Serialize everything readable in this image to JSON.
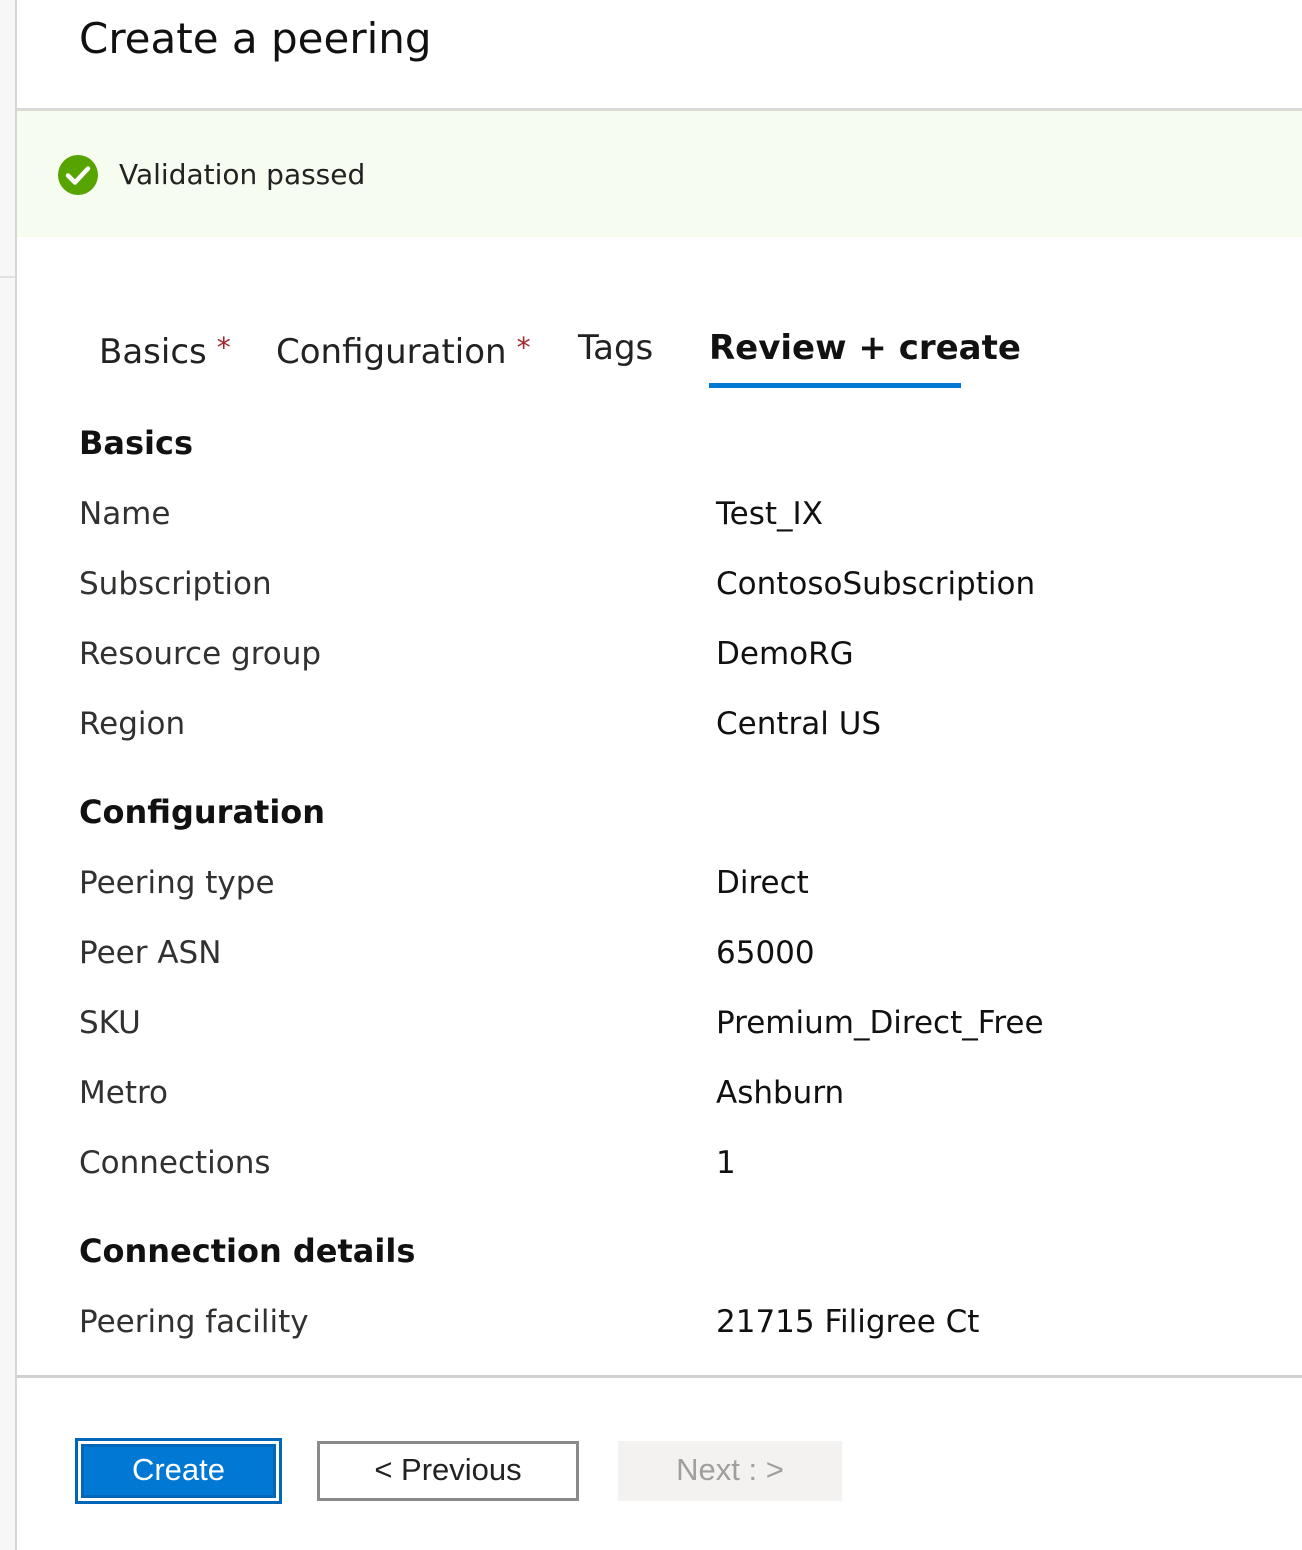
{
  "page": {
    "title": "Create a peering"
  },
  "validation": {
    "status": "success",
    "message": "Validation passed",
    "icon": "checkmark-circle-icon",
    "color": "#57a300"
  },
  "tabs": [
    {
      "label": "Basics",
      "required": true,
      "required_mark": "*",
      "active": false
    },
    {
      "label": "Configuration",
      "required": true,
      "required_mark": "*",
      "active": false
    },
    {
      "label": "Tags",
      "required": false,
      "active": false
    },
    {
      "label": "Review + create",
      "required": false,
      "active": true
    }
  ],
  "sections": {
    "basics": {
      "heading": "Basics",
      "rows": [
        {
          "label": "Name",
          "value": "Test_IX"
        },
        {
          "label": "Subscription",
          "value": "ContosoSubscription"
        },
        {
          "label": "Resource group",
          "value": "DemoRG"
        },
        {
          "label": "Region",
          "value": "Central US"
        }
      ]
    },
    "configuration": {
      "heading": "Configuration",
      "rows": [
        {
          "label": "Peering type",
          "value": "Direct"
        },
        {
          "label": "Peer ASN",
          "value": "65000"
        },
        {
          "label": "SKU",
          "value": "Premium_Direct_Free"
        },
        {
          "label": "Metro",
          "value": "Ashburn"
        },
        {
          "label": "Connections",
          "value": "1"
        }
      ]
    },
    "connection_details": {
      "heading": "Connection details",
      "rows": [
        {
          "label": "Peering facility",
          "value": "21715 Filigree Ct"
        }
      ]
    }
  },
  "footer": {
    "create_label": "Create",
    "previous_label": "< Previous",
    "next_label": "Next : >",
    "next_disabled": true
  },
  "colors": {
    "accent": "#0078d4",
    "required": "#a4262c",
    "success": "#57a300",
    "banner_bg": "#f6fcef"
  }
}
